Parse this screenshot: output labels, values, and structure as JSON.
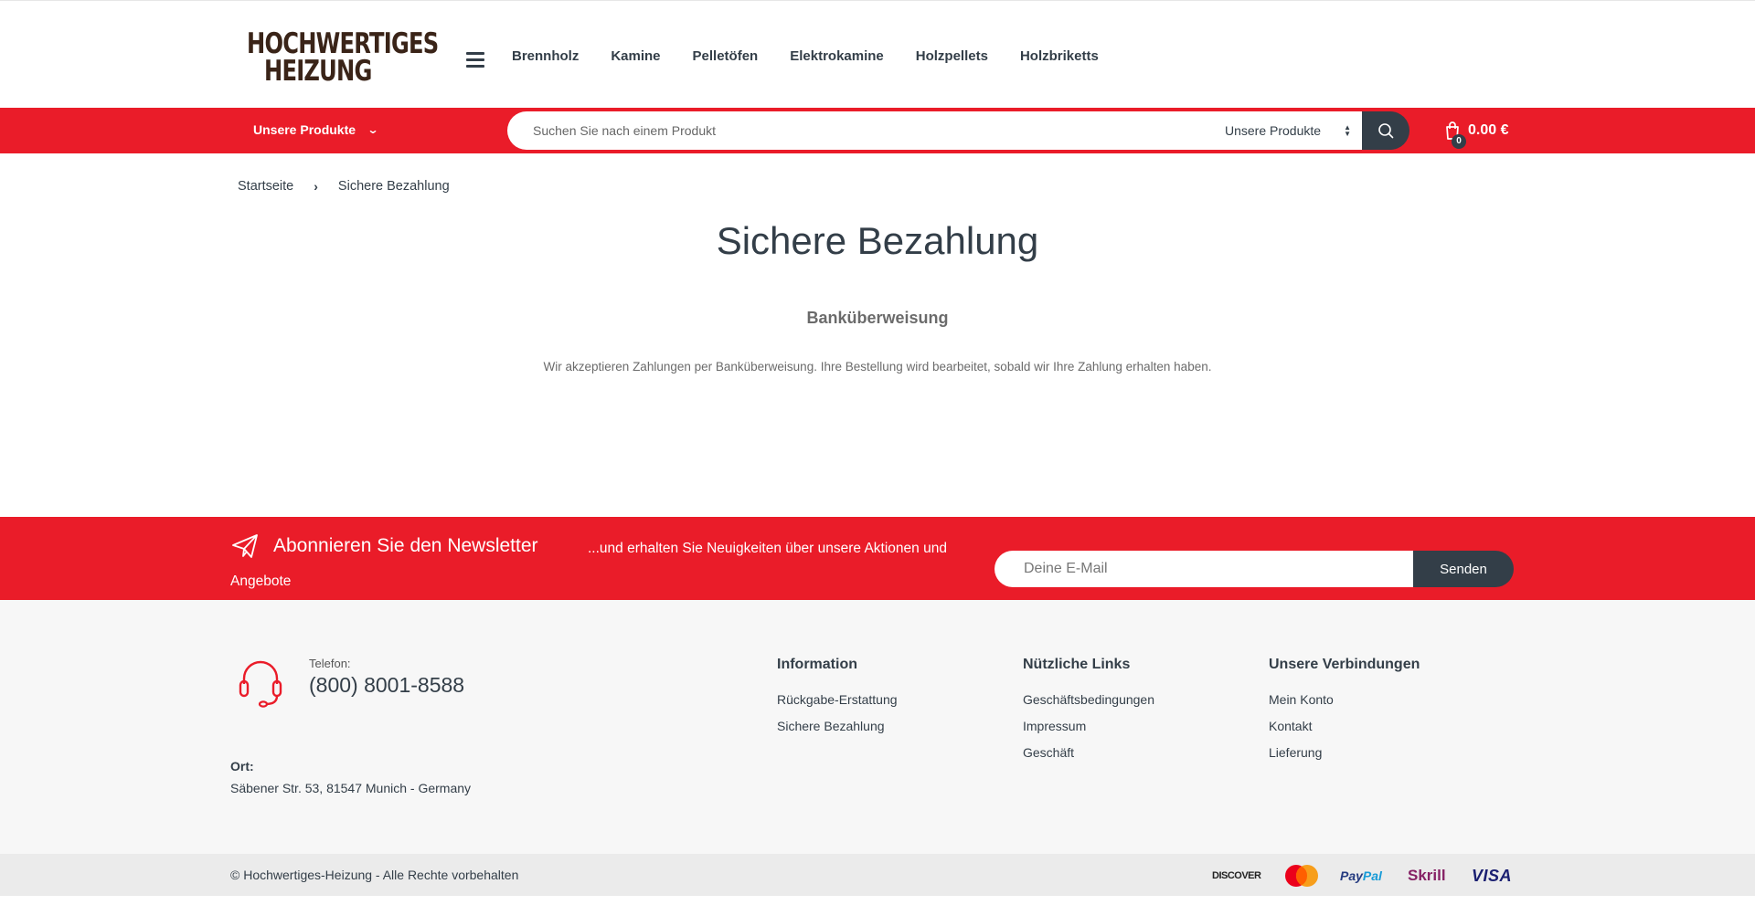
{
  "header": {
    "logo_line1": "HOCHWERTIGES",
    "logo_line2": "HEIZUNG",
    "nav": [
      "Brennholz",
      "Kamine",
      "Pelletöfen",
      "Elektrokamine",
      "Holzpellets",
      "Holzbriketts"
    ]
  },
  "redbar": {
    "categories_label": "Unsere Produkte",
    "search_placeholder": "Suchen Sie nach einem Produkt",
    "search_category": "Unsere Produkte",
    "cart_count": "0",
    "cart_total": "0.00 €"
  },
  "breadcrumb": {
    "home": "Startseite",
    "current": "Sichere Bezahlung"
  },
  "content": {
    "title": "Sichere Bezahlung",
    "section_heading": "Banküberweisung",
    "section_text": "Wir akzeptieren Zahlungen per Banküberweisung. Ihre Bestellung wird bearbeitet, sobald wir Ihre Zahlung erhalten haben."
  },
  "newsletter": {
    "title": "Abonnieren Sie den Newsletter",
    "text_line1": "...und erhalten Sie Neuigkeiten über unsere Aktionen und",
    "text_line2": "Angebote",
    "email_placeholder": "Deine E-Mail",
    "button": "Senden"
  },
  "footer": {
    "phone_label": "Telefon:",
    "phone_number": "(800) 8001-8588",
    "location_label": "Ort:",
    "location_value": "Säbener Str. 53, 81547 Munich - Germany",
    "columns": [
      {
        "title": "Information",
        "links": [
          "Rückgabe-Erstattung",
          "Sichere Bezahlung"
        ]
      },
      {
        "title": "Nützliche Links",
        "links": [
          "Geschäftsbedingungen",
          "Impressum",
          "Geschäft"
        ]
      },
      {
        "title": "Unsere Verbindungen",
        "links": [
          "Mein Konto",
          "Kontakt",
          "Lieferung"
        ]
      }
    ]
  },
  "bottom": {
    "copyright": "© Hochwertiges-Heizung - Alle Rechte vorbehalten",
    "payment_icons": [
      "discover-icon",
      "mastercard-icon",
      "paypal-icon",
      "skrill-icon",
      "visa-icon"
    ],
    "payment_labels": {
      "discover": "DISCOVER",
      "paypal_1": "Pay",
      "paypal_2": "Pal",
      "skrill": "Skrill",
      "visa": "VISA"
    }
  },
  "colors": {
    "accent_red": "#ea1c29",
    "dark": "#333e48",
    "footer_bg": "#f7f7f7",
    "bottom_bg": "#ebebeb"
  }
}
